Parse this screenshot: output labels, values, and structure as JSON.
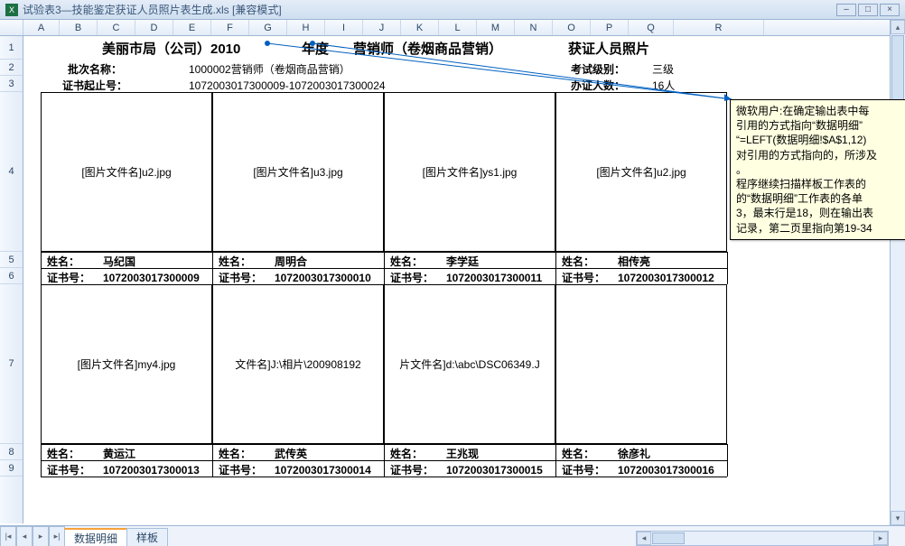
{
  "window": {
    "title": "试验表3—技能鉴定获证人员照片表生成.xls  [兼容模式]",
    "min": "–",
    "max": "□",
    "close": "×"
  },
  "cols": [
    "A",
    "B",
    "C",
    "D",
    "E",
    "F",
    "G",
    "H",
    "I",
    "J",
    "K",
    "L",
    "M",
    "N",
    "O",
    "P",
    "Q",
    "R"
  ],
  "rownums": [
    "1",
    "2",
    "3",
    "4",
    "5",
    "6",
    "7",
    "8",
    "9"
  ],
  "title_row": {
    "t1": "美丽市局（公司）2010",
    "t2": "年度",
    "t3": "营销师（卷烟商品营销）",
    "t4": "获证人员照片"
  },
  "row2": {
    "batch_lbl": "批次名称：",
    "batch_val": "1000002营销师（卷烟商品营销）",
    "exam_lvl_lbl": "考试级别：",
    "exam_lvl_val": "三级"
  },
  "row3": {
    "cert_range_lbl": "证书起止号：",
    "cert_range_val": "1072003017300009-1072003017300024",
    "count_lbl": "办证人数：",
    "count_val": "16人"
  },
  "photos_row1": [
    "[图片文件名]u2.jpg",
    "[图片文件名]u3.jpg",
    "[图片文件名]ys1.jpg",
    "[图片文件名]u2.jpg"
  ],
  "info_row1": {
    "name_lbl": "姓名：",
    "cert_lbl": "证书号：",
    "people": [
      {
        "name": "马纪国",
        "cert": "1072003017300009"
      },
      {
        "name": "周明合",
        "cert": "1072003017300010"
      },
      {
        "name": "李学廷",
        "cert": "1072003017300011"
      },
      {
        "name": "相传亮",
        "cert": "1072003017300012"
      }
    ]
  },
  "photos_row2": [
    "[图片文件名]my4.jpg",
    "文件名]J:\\相片\\200908192",
    "片文件名]d:\\abc\\DSC06349.J",
    ""
  ],
  "info_row2": {
    "name_lbl": "姓名：",
    "cert_lbl": "证书号：",
    "people": [
      {
        "name": "黄运江",
        "cert": "1072003017300013"
      },
      {
        "name": "武传英",
        "cert": "1072003017300014"
      },
      {
        "name": "王兆现",
        "cert": "1072003017300015"
      },
      {
        "name": "徐彦礼",
        "cert": "1072003017300016"
      }
    ]
  },
  "comment": {
    "l1": "微软用户:在确定输出表中每",
    "l2": "引用的方式指向“数据明细”",
    "l3": "  “=LEFT(数据明细!$A$1,12)",
    "l4": "对引用的方式指向的，所涉及",
    "l5": "。",
    "l6": "  程序继续扫描样板工作表的",
    "l7": "的“数据明细”工作表的各单",
    "l8": "3，最末行是18，则在输出表",
    "l9": "记录，第二页里指向第19-34"
  },
  "tabs": {
    "t1": "数据明细",
    "t2": "样板"
  },
  "arrows": {
    "first": "|◂",
    "prev": "◂",
    "next": "▸",
    "last": "▸|",
    "left": "◂",
    "right": "▸",
    "up": "▴",
    "down": "▾"
  }
}
